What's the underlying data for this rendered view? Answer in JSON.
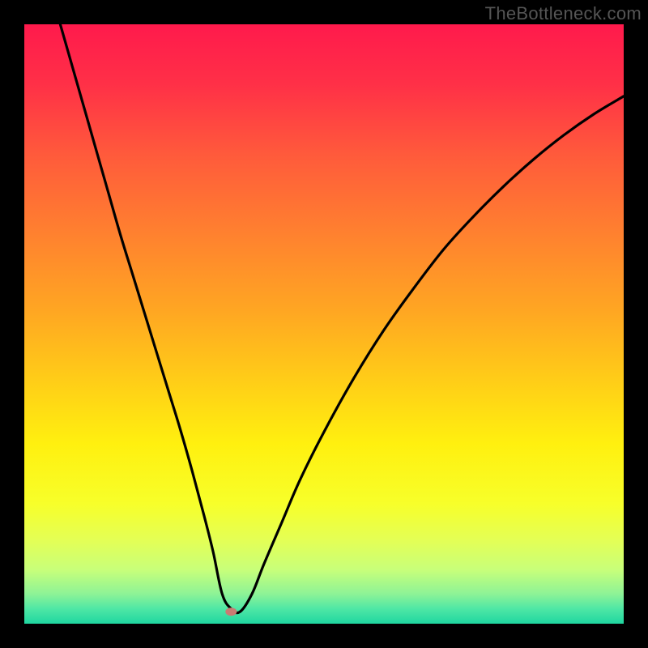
{
  "watermark": "TheBottleneck.com",
  "gradient_stops": [
    {
      "offset": 0.0,
      "color": "#ff1a4c"
    },
    {
      "offset": 0.1,
      "color": "#ff3047"
    },
    {
      "offset": 0.22,
      "color": "#ff5b3b"
    },
    {
      "offset": 0.35,
      "color": "#ff812f"
    },
    {
      "offset": 0.48,
      "color": "#ffa722"
    },
    {
      "offset": 0.6,
      "color": "#ffcf17"
    },
    {
      "offset": 0.7,
      "color": "#fff00f"
    },
    {
      "offset": 0.8,
      "color": "#f7ff2a"
    },
    {
      "offset": 0.86,
      "color": "#e4ff55"
    },
    {
      "offset": 0.91,
      "color": "#c8ff7a"
    },
    {
      "offset": 0.95,
      "color": "#8ef396"
    },
    {
      "offset": 0.975,
      "color": "#4fe7a5"
    },
    {
      "offset": 1.0,
      "color": "#1fd6a0"
    }
  ],
  "chart_data": {
    "type": "line",
    "title": "",
    "xlabel": "",
    "ylabel": "",
    "xlim": [
      0,
      100
    ],
    "ylim": [
      0,
      100
    ],
    "grid": false,
    "legend": false,
    "valley_x": 33,
    "marker": {
      "x": 34.5,
      "y": 2,
      "color": "#c97b73"
    },
    "series": [
      {
        "name": "curve",
        "color": "#000000",
        "x": [
          6,
          8,
          10,
          12,
          14,
          16,
          18,
          20,
          22,
          24,
          26,
          28,
          30,
          31.5,
          33,
          34.5,
          36,
          38,
          40,
          43,
          46,
          50,
          55,
          60,
          65,
          70,
          75,
          80,
          85,
          90,
          95,
          100
        ],
        "y": [
          100,
          93,
          86,
          79,
          72,
          65,
          58.5,
          52,
          45.5,
          39,
          32.5,
          25.5,
          18,
          12,
          5,
          2.5,
          2,
          5,
          10,
          17,
          24,
          32,
          41,
          49,
          56,
          62.5,
          68,
          73,
          77.5,
          81.5,
          85,
          88
        ]
      }
    ]
  }
}
